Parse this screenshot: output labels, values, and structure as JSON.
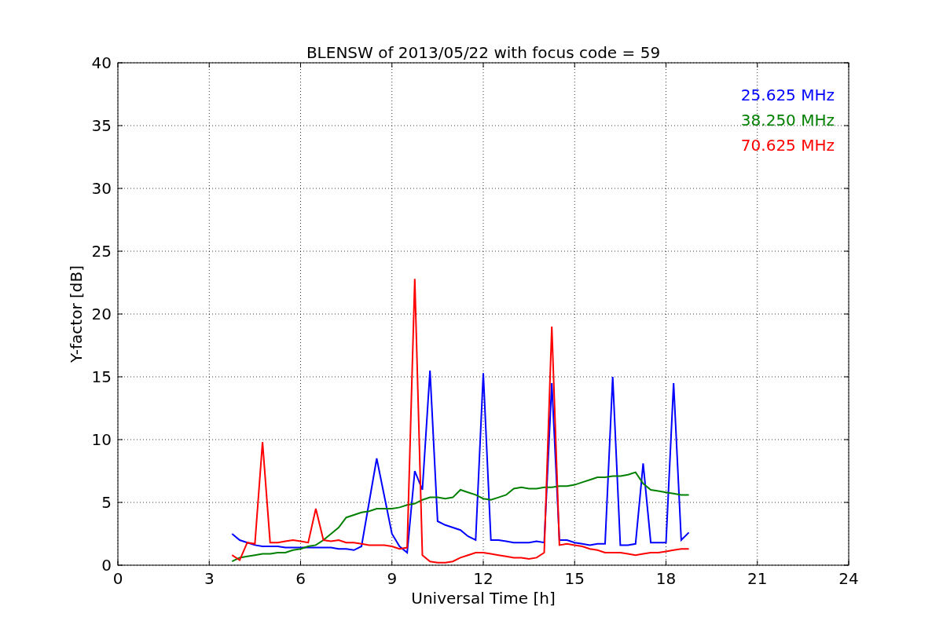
{
  "chart": {
    "chart_data": {
      "type": "line",
      "title": "BLENSW of 2013/05/22 with focus code = 59",
      "xlabel": "Universal Time [h]",
      "ylabel": "Y-factor [dB]",
      "x": [
        3.75,
        4,
        4.25,
        4.5,
        4.75,
        5,
        5.25,
        5.5,
        5.75,
        6,
        6.25,
        6.5,
        6.75,
        7,
        7.25,
        7.5,
        7.75,
        8,
        8.25,
        8.5,
        8.75,
        9,
        9.25,
        9.5,
        9.75,
        10,
        10.25,
        10.5,
        10.75,
        11,
        11.25,
        11.5,
        11.75,
        12,
        12.25,
        12.5,
        12.75,
        13,
        13.25,
        13.5,
        13.75,
        14,
        14.25,
        14.5,
        14.75,
        15,
        15.25,
        15.5,
        15.75,
        16,
        16.25,
        16.5,
        16.75,
        17,
        17.25,
        17.5,
        17.75,
        18,
        18.25,
        18.5,
        18.75
      ],
      "series": [
        {
          "name": "25.625 MHz",
          "color": "#0000ff",
          "values": [
            2.5,
            2.0,
            1.8,
            1.6,
            1.5,
            1.5,
            1.5,
            1.4,
            1.4,
            1.4,
            1.4,
            1.4,
            1.4,
            1.4,
            1.3,
            1.3,
            1.2,
            1.5,
            5,
            8.5,
            5.5,
            2.5,
            1.5,
            1.0,
            7.5,
            6,
            15.5,
            3.5,
            3.2,
            3,
            2.8,
            2.3,
            2,
            15.3,
            2,
            2,
            1.9,
            1.8,
            1.8,
            1.8,
            1.9,
            1.8,
            14.5,
            2.0,
            2,
            1.8,
            1.7,
            1.6,
            1.7,
            1.7,
            15,
            1.6,
            1.6,
            1.7,
            8.1,
            1.8,
            1.8,
            1.8,
            14.5,
            2.0,
            2.6
          ]
        },
        {
          "name": "38.250 MHz",
          "color": "#008000",
          "values": [
            0.3,
            0.6,
            0.7,
            0.8,
            0.9,
            0.9,
            1.0,
            1.0,
            1.2,
            1.3,
            1.5,
            1.6,
            2.0,
            2.5,
            3.0,
            3.8,
            4.0,
            4.2,
            4.3,
            4.5,
            4.5,
            4.5,
            4.6,
            4.8,
            4.9,
            5.2,
            5.4,
            5.4,
            5.3,
            5.4,
            6.0,
            5.8,
            5.6,
            5.3,
            5.2,
            5.4,
            5.6,
            6.1,
            6.2,
            6.1,
            6.1,
            6.2,
            6.2,
            6.3,
            6.3,
            6.4,
            6.6,
            6.8,
            7.0,
            7.0,
            7.1,
            7.1,
            7.2,
            7.4,
            6.5,
            6.0,
            5.9,
            5.8,
            5.7,
            5.6,
            5.6
          ]
        },
        {
          "name": "70.625 MHz",
          "color": "#ff0000",
          "values": [
            0.8,
            0.4,
            1.8,
            1.7,
            9.8,
            1.8,
            1.8,
            1.9,
            2.0,
            1.9,
            1.8,
            4.5,
            2.0,
            1.9,
            2.0,
            1.8,
            1.8,
            1.7,
            1.6,
            1.6,
            1.6,
            1.5,
            1.3,
            1.4,
            22.8,
            0.8,
            0.3,
            0.2,
            0.2,
            0.3,
            0.6,
            0.8,
            1.0,
            1.0,
            0.9,
            0.8,
            0.7,
            0.6,
            0.6,
            0.5,
            0.6,
            1.0,
            19,
            1.6,
            1.7,
            1.6,
            1.5,
            1.3,
            1.2,
            1.0,
            1.0,
            1.0,
            0.9,
            0.8,
            0.9,
            1.0,
            1.0,
            1.1,
            1.2,
            1.3,
            1.3
          ]
        }
      ],
      "xlim": [
        0,
        24
      ],
      "ylim": [
        0,
        40
      ],
      "xticks": [
        0,
        3,
        6,
        9,
        12,
        15,
        18,
        21,
        24
      ],
      "yticks": [
        0,
        5,
        10,
        15,
        20,
        25,
        30,
        35,
        40
      ],
      "grid": true
    }
  }
}
